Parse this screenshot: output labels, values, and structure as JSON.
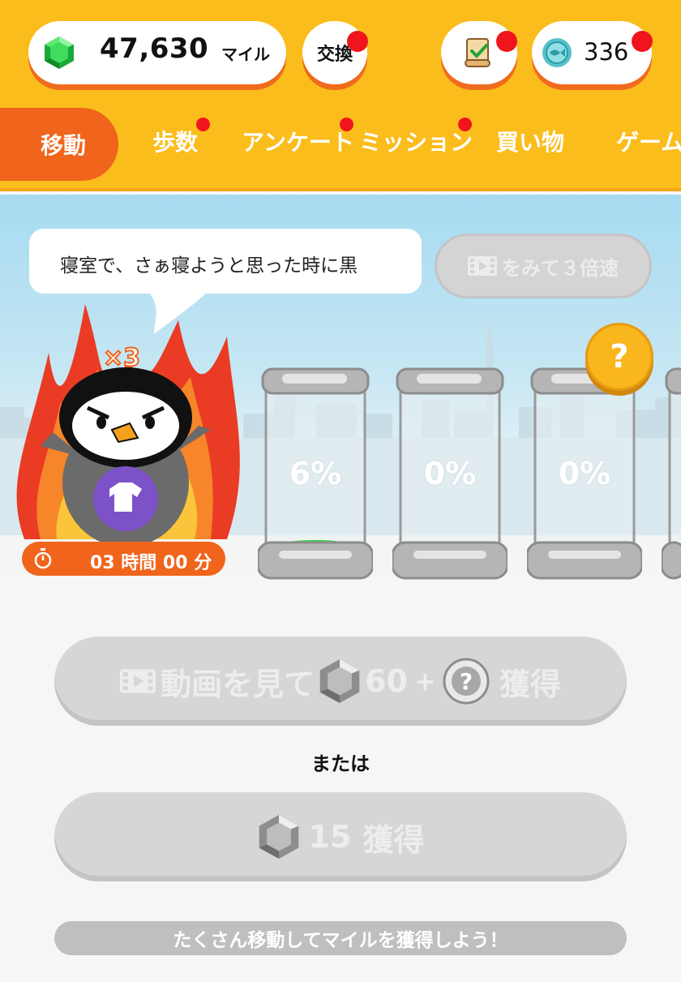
{
  "header": {
    "miles_value": "47,630",
    "miles_unit": "マイル",
    "exchange_label": "交換",
    "coin_value": "336",
    "icons": {
      "miles": "green-gem-icon",
      "mission": "scroll-check-icon",
      "coin": "fish-coin-icon"
    }
  },
  "tabs": [
    {
      "label": "移動",
      "active": true,
      "badge": false
    },
    {
      "label": "歩数",
      "active": false,
      "badge": true
    },
    {
      "label": "アンケート",
      "active": false,
      "badge": true
    },
    {
      "label": "ミッション",
      "active": false,
      "badge": true
    },
    {
      "label": "買い物",
      "active": false,
      "badge": false
    },
    {
      "label": "ゲーム",
      "active": false,
      "badge": false
    }
  ],
  "scene": {
    "bubble_text": "寝室で、さぁ寝ようと思った時に黒",
    "speed_button_label": "をみて３倍速",
    "multiplier": "×3",
    "timer": "03 時間 00 分",
    "jars": [
      {
        "percent_label": "6%",
        "fill": 0.06
      },
      {
        "percent_label": "0%",
        "fill": 0
      },
      {
        "percent_label": "0%",
        "fill": 0
      }
    ],
    "question_badge": "?"
  },
  "actions": {
    "video_button_prefix": "動画を見て",
    "video_button_amount": "60",
    "video_button_plus": "+",
    "video_button_suffix": "獲得",
    "or_text": "または",
    "earn_button_amount": "15",
    "earn_button_suffix": "獲得",
    "info_text": "たくさん移動してマイルを獲得しよう！"
  },
  "colors": {
    "header": "#fbbd1c",
    "accent": "#f0641b",
    "badge": "#f0151d",
    "disabled": "#d6d6d6"
  }
}
